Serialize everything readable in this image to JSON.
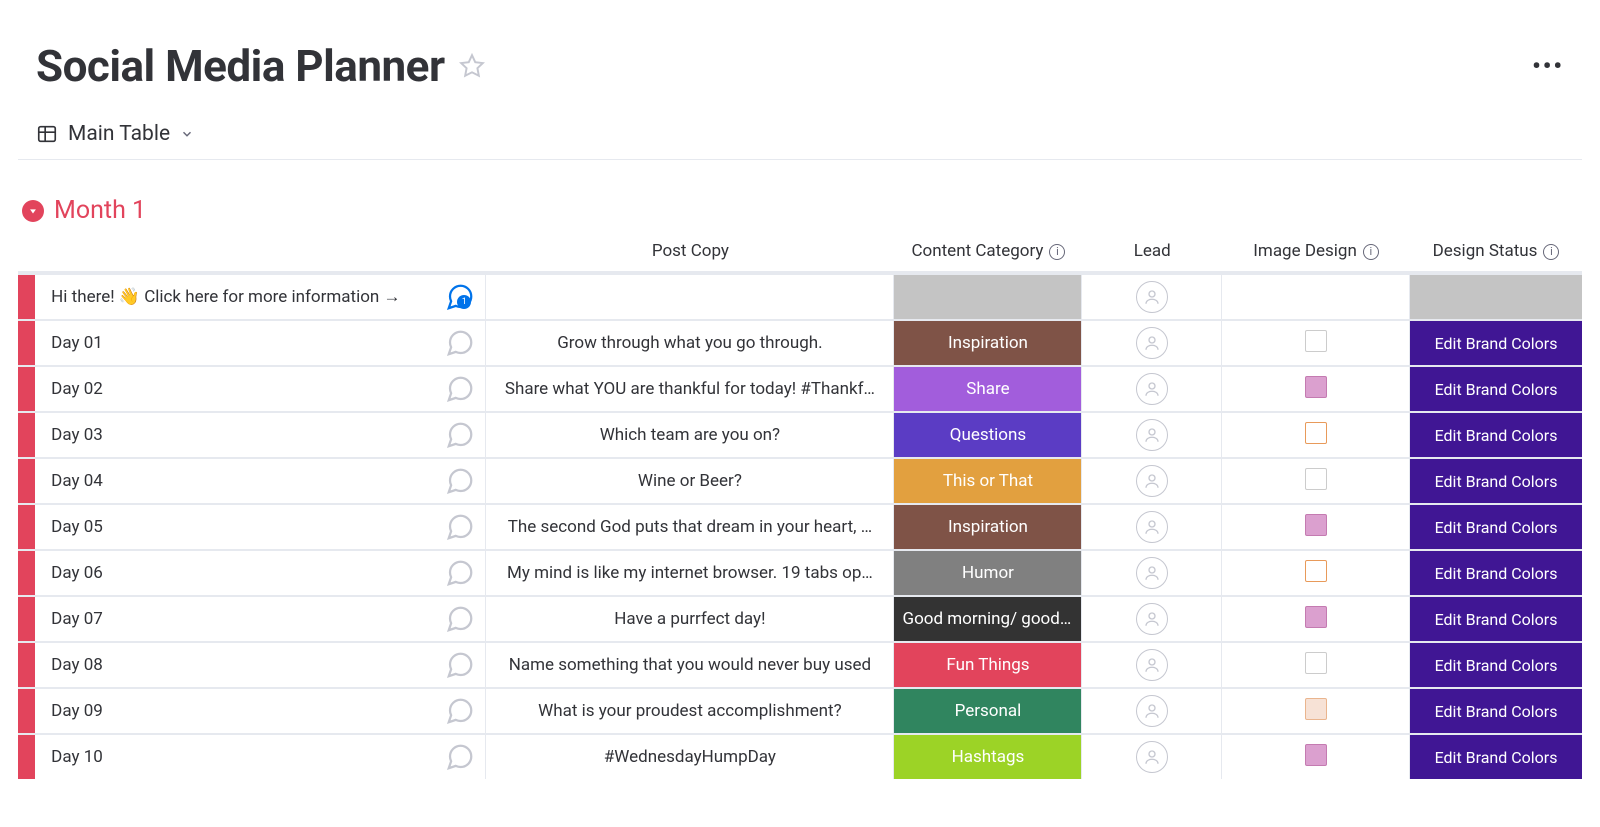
{
  "header": {
    "title": "Social Media Planner"
  },
  "view": {
    "label": "Main Table"
  },
  "group": {
    "title": "Month 1"
  },
  "columns": {
    "post_copy": "Post Copy",
    "content_category": "Content Category",
    "lead": "Lead",
    "image_design": "Image Design",
    "design_status": "Design Status"
  },
  "status_label": "Edit Brand Colors",
  "category_colors": {
    "Inspiration": "#7f5347",
    "Share": "#a25ddc",
    "Questions": "#5b3cc4",
    "This or That": "#e2a03f",
    "Humor": "#808080",
    "Good morning/ good night": "#333333",
    "Fun Things": "#e2445c",
    "Personal": "#30855f",
    "Hashtags": "#9cd326"
  },
  "rows": [
    {
      "name": "Hi there! 👋 Click here for more information →",
      "copy": "",
      "category": "",
      "status": "",
      "chat": true,
      "thumb": ""
    },
    {
      "name": "Day 01",
      "copy": "Grow through what you go through.",
      "category": "Inspiration",
      "status": "Edit Brand Colors",
      "thumb": "t4"
    },
    {
      "name": "Day 02",
      "copy": "Share what YOU are thankful for today! #Thankf…",
      "category": "Share",
      "status": "Edit Brand Colors",
      "thumb": "t2"
    },
    {
      "name": "Day 03",
      "copy": "Which team are you on?",
      "category": "Questions",
      "status": "Edit Brand Colors",
      "thumb": "t3"
    },
    {
      "name": "Day 04",
      "copy": "Wine or Beer?",
      "category": "This or That",
      "status": "Edit Brand Colors",
      "thumb": "t4"
    },
    {
      "name": "Day 05",
      "copy": "The second God puts that dream in your heart, …",
      "category": "Inspiration",
      "status": "Edit Brand Colors",
      "thumb": "t2"
    },
    {
      "name": "Day 06",
      "copy": "My mind is like my internet browser. 19 tabs op…",
      "category": "Humor",
      "status": "Edit Brand Colors",
      "thumb": "t3"
    },
    {
      "name": "Day 07",
      "copy": "Have a purrfect day!",
      "category": "Good morning/ good …",
      "status": "Edit Brand Colors",
      "thumb": "t2"
    },
    {
      "name": "Day 08",
      "copy": "Name something that you would never buy used",
      "category": "Fun Things",
      "status": "Edit Brand Colors",
      "thumb": "t4"
    },
    {
      "name": "Day 09",
      "copy": "What is your proudest accomplishment?",
      "category": "Personal",
      "status": "Edit Brand Colors",
      "thumb": "t1"
    },
    {
      "name": "Day 10",
      "copy": "#WednesdayHumpDay",
      "category": "Hashtags",
      "status": "Edit Brand Colors",
      "thumb": "t2"
    }
  ]
}
